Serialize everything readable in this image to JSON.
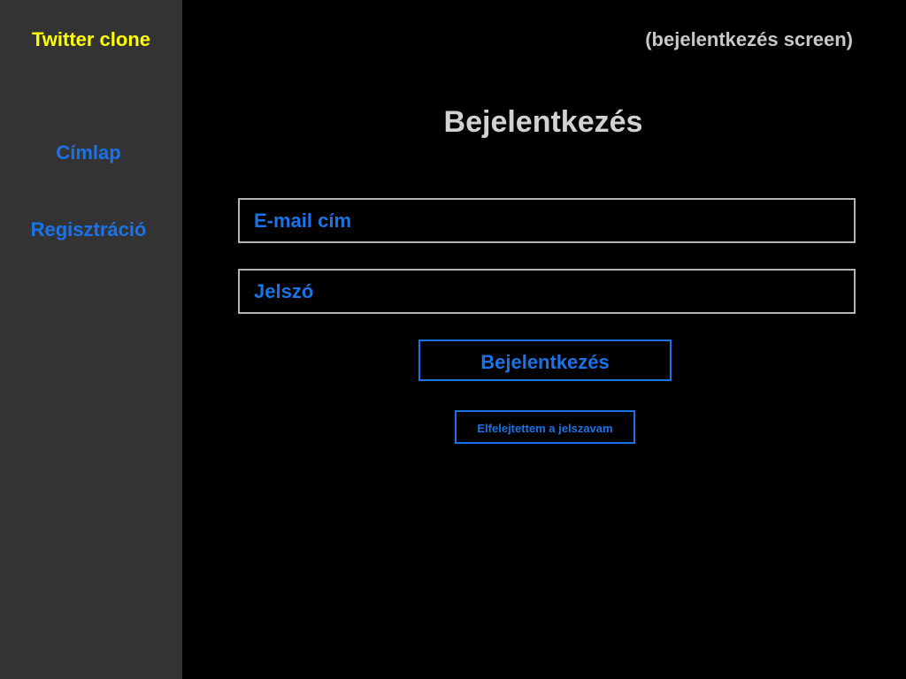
{
  "sidebar": {
    "brand": "Twitter clone",
    "nav": {
      "home_label": "Címlap",
      "register_label": "Regisztráció"
    }
  },
  "main": {
    "screen_label": "(bejelentkezés screen)",
    "title": "Bejelentkezés",
    "form": {
      "email": {
        "placeholder": "E-mail cím",
        "value": ""
      },
      "password": {
        "placeholder": "Jelszó",
        "value": ""
      },
      "submit_label": "Bejelentkezés",
      "forgot_label": "Elfelejtettem a jelszavam"
    }
  },
  "colors": {
    "sidebar_bg": "#333333",
    "main_bg": "#000000",
    "brand": "#ffff00",
    "accent": "#1a73e8",
    "muted_text": "#c8c8c8",
    "input_border": "#b4b4b4"
  }
}
